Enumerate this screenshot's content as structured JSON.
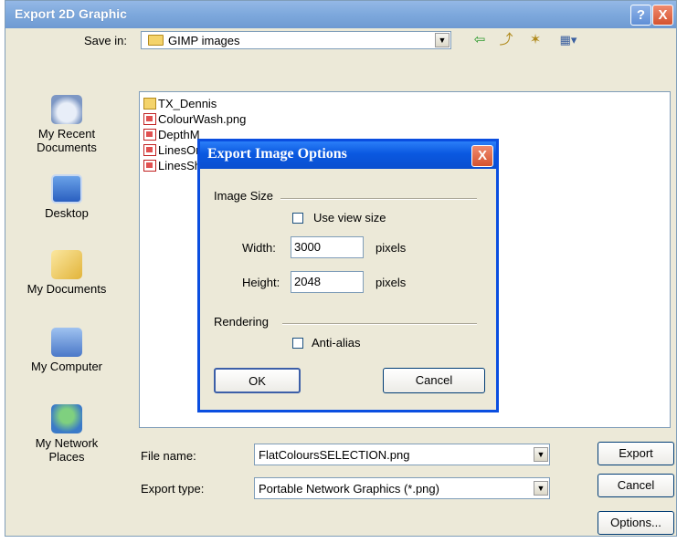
{
  "outer": {
    "title": "Export 2D Graphic",
    "help": "?",
    "close": "X"
  },
  "save_in": {
    "label": "Save in:",
    "value": "GIMP images"
  },
  "places": [
    {
      "label": "My Recent Documents",
      "icon": "recent-documents-icon"
    },
    {
      "label": "Desktop",
      "icon": "desktop-icon"
    },
    {
      "label": "My Documents",
      "icon": "my-documents-icon"
    },
    {
      "label": "My Computer",
      "icon": "my-computer-icon"
    },
    {
      "label": "My Network Places",
      "icon": "network-places-icon"
    }
  ],
  "files": [
    {
      "name": "TX_Dennis",
      "type": "folder"
    },
    {
      "name": "ColourWash.png",
      "type": "png"
    },
    {
      "name": "DepthM",
      "type": "png"
    },
    {
      "name": "LinesOr",
      "type": "png"
    },
    {
      "name": "LinesSh",
      "type": "png"
    }
  ],
  "file_name": {
    "label": "File name:",
    "value": "FlatColoursSELECTION.png"
  },
  "export_type": {
    "label": "Export type:",
    "value": "Portable Network Graphics (*.png)"
  },
  "buttons": {
    "export": "Export",
    "cancel": "Cancel",
    "options": "Options..."
  },
  "inner": {
    "title": "Export Image Options",
    "close": "X",
    "image_size_group": "Image Size",
    "use_view_size": "Use view size",
    "width_label": "Width:",
    "width_value": "3000",
    "width_unit": "pixels",
    "height_label": "Height:",
    "height_value": "2048",
    "height_unit": "pixels",
    "rendering_group": "Rendering",
    "anti_alias": "Anti-alias",
    "ok": "OK",
    "cancel": "Cancel"
  },
  "colors": {
    "outer_title_bar": "#7da8dc",
    "inner_title_bar": "#0a58e0",
    "dialog_face": "#ece9d8"
  }
}
